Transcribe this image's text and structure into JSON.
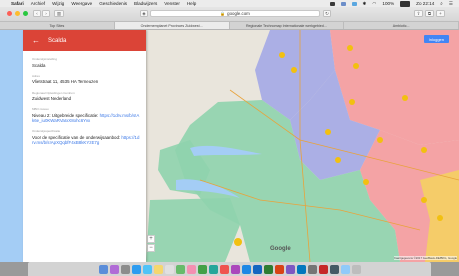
{
  "menubar": {
    "items": [
      "Safari",
      "Archief",
      "Wijzig",
      "Weergave",
      "Geschiedenis",
      "Bladwijzers",
      "Venster",
      "Help"
    ],
    "right": {
      "battery": "100%",
      "clock": "Zo 22:14"
    }
  },
  "toolbar": {
    "url": "google.com"
  },
  "tabs": [
    "Top Sites",
    "Ondernemplanet Provinces Zuidwest...",
    "Regionale Technomap Internationale werkgebied...",
    "Ambiotic..."
  ],
  "panel": {
    "title": "Scalda",
    "fields": [
      {
        "label": "Onderwijsinstelling",
        "value": "Scalda"
      },
      {
        "label": "Adres",
        "value": "Vlietstraat 11, 4535 HA Terneuzen"
      },
      {
        "label": "Regionaal Opleidingen Centrum",
        "value": "Zuidwest Nederland"
      },
      {
        "label": "MBO niveau",
        "value_prefix": "Niveau 2: Uitgebreide specificatie:",
        "link": "https://1drv.ms/b/s!Ak6e_iu0KWaRVaIxX8ohc6Yvx"
      },
      {
        "label": "Onderwijsspecificatie",
        "value_prefix": "Voor de specificatie van de onderwijsaanbod:",
        "link": "https://1drv.ms/b/s!ApXQqbfF4xB8kKYzE7g"
      }
    ]
  },
  "map": {
    "signin_label": "Inloggen",
    "google_label": "Google",
    "attribution": "Kaartgegevens ©2017 GeoBasis-DE/BKG, Google"
  },
  "colors": {
    "accent": "#db4437",
    "link": "#3b78e7",
    "sea": "#a4cdf5",
    "land": "#e9e5dc",
    "green_region": "#8fd3ad",
    "purple_region": "#a4a9e6",
    "pink_region": "#f59b9e",
    "yellow_region": "#f4d35e",
    "marker": "#f2c010"
  }
}
